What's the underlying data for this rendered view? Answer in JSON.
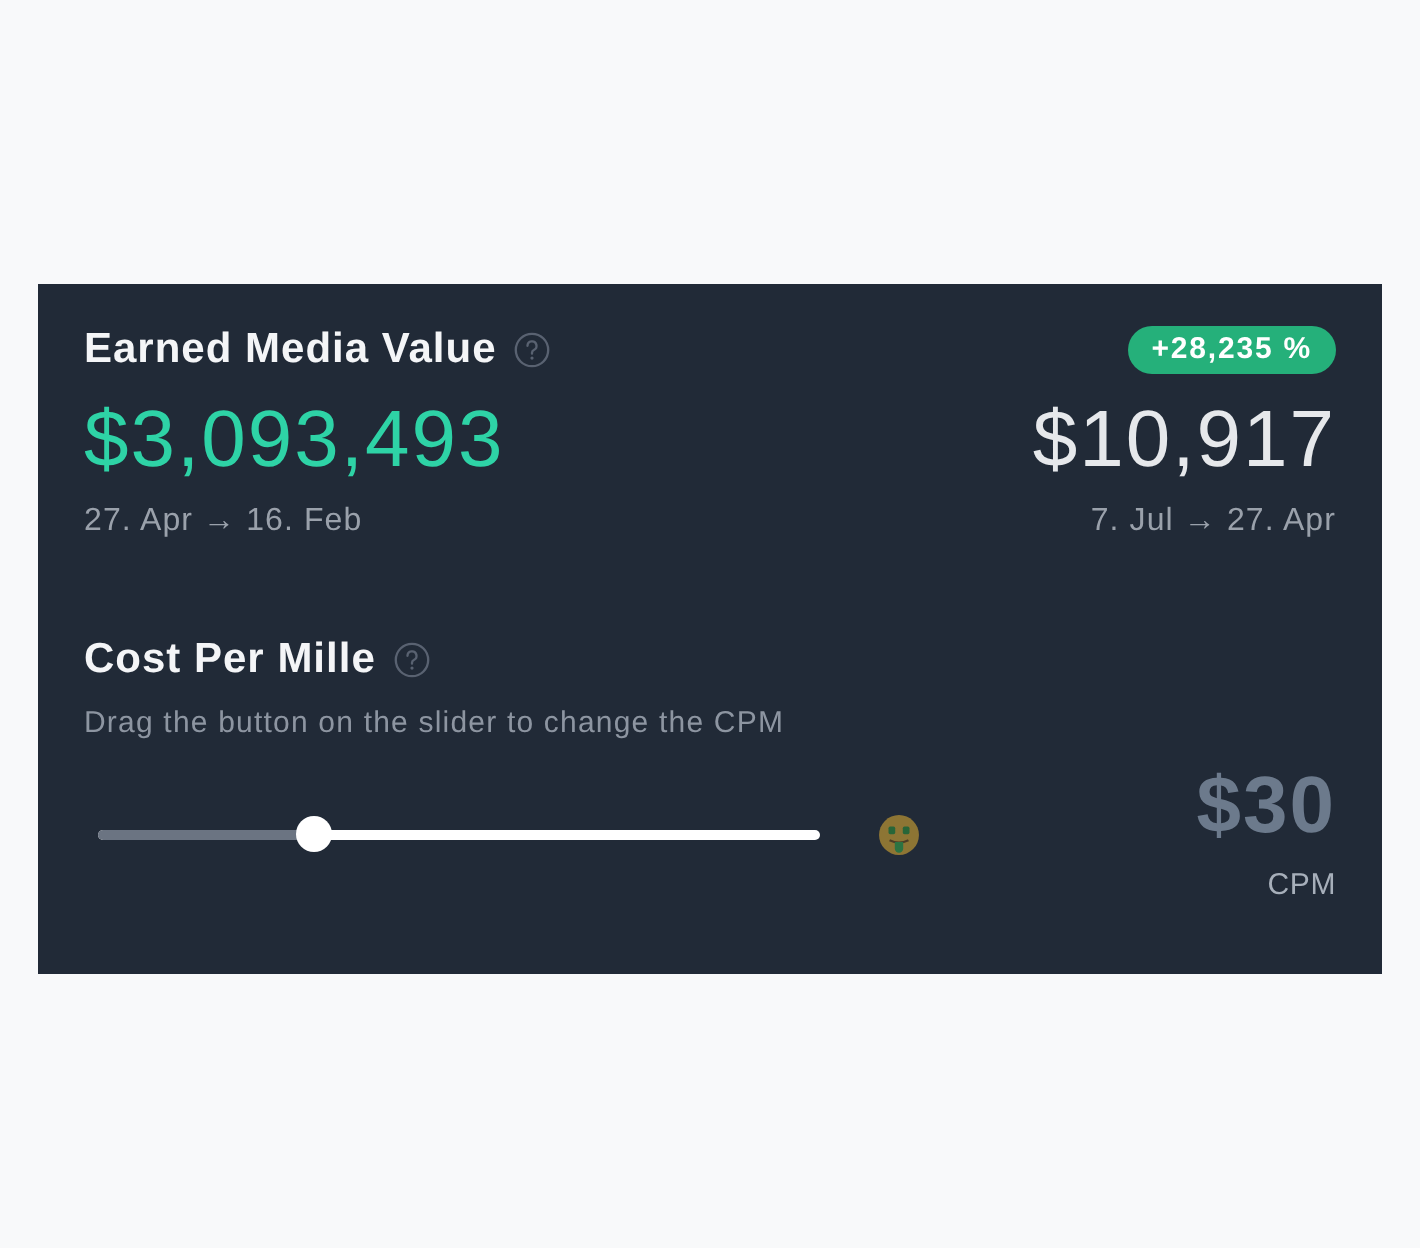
{
  "earned_media_value": {
    "title": "Earned Media Value",
    "value": "$3,093,493",
    "date_range": "27. Apr → 16. Feb"
  },
  "comparison": {
    "change_badge": "+28,235 %",
    "value": "$10,917",
    "date_range": "7. Jul → 27. Apr"
  },
  "cost_per_mille": {
    "title": "Cost Per Mille",
    "description": "Drag the button on the slider to change the CPM",
    "slider": {
      "level": 0.3
    },
    "value": "$30",
    "unit": "CPM"
  }
}
